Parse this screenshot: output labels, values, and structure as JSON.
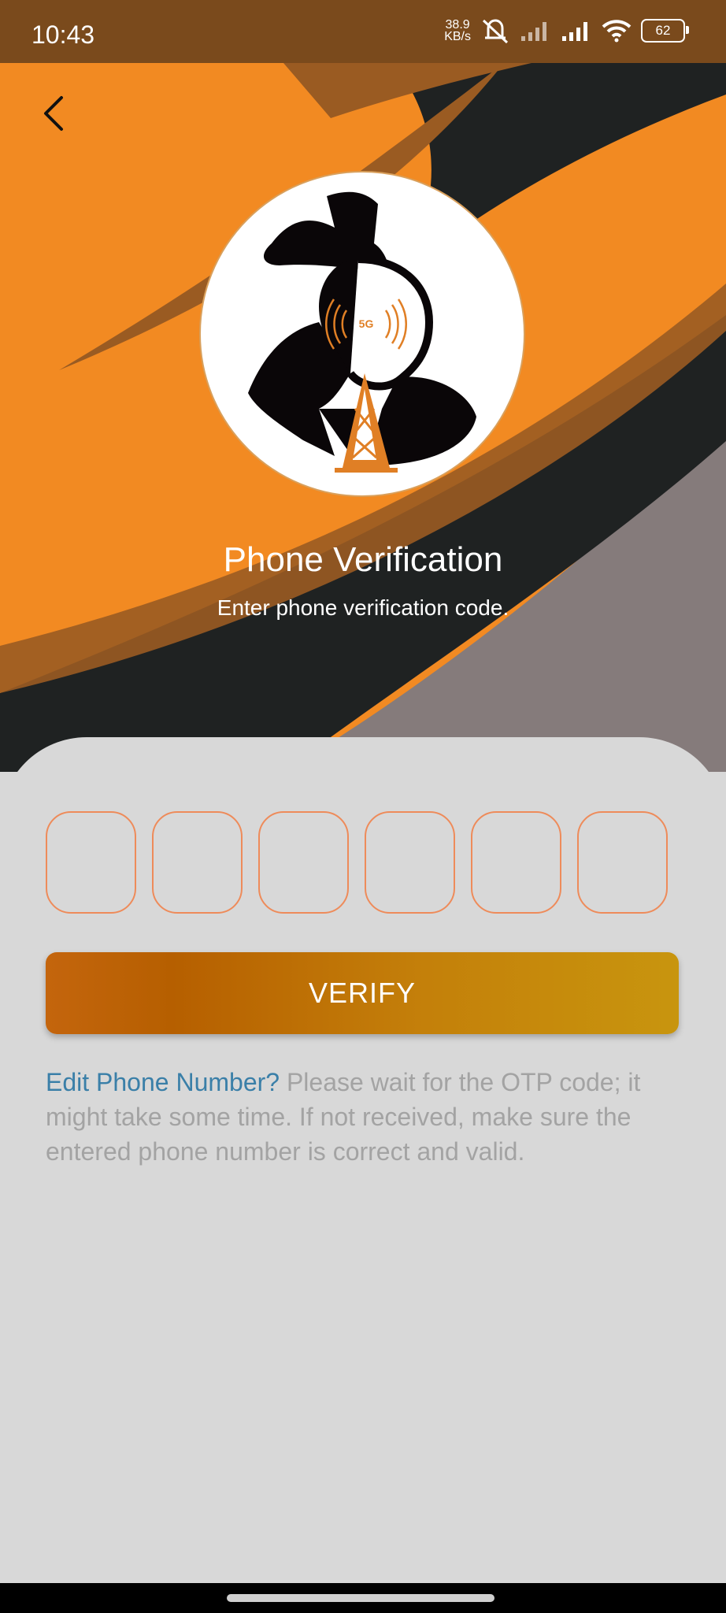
{
  "status_bar": {
    "time": "10:43",
    "net_speed_value": "38.9",
    "net_speed_unit": "KB/s",
    "battery": "62",
    "icons": [
      "mute-icon",
      "signal-icon",
      "signal-icon",
      "wifi-icon",
      "battery-icon"
    ]
  },
  "header": {
    "back_icon": "chevron-left-icon",
    "logo_label": "5G",
    "title": "Phone Verification",
    "subtitle": "Enter phone verification code."
  },
  "otp": {
    "digits": [
      "",
      "",
      "",
      "",
      "",
      ""
    ]
  },
  "verify_button": {
    "label": "VERIFY"
  },
  "note": {
    "link": "Edit Phone Number?",
    "text": " Please wait for the OTP code; it might take some time. If not received, make sure the entered phone number is correct and valid."
  },
  "colors": {
    "orange": "#f28a22",
    "dark": "#1f2222",
    "gray": "#857b7b",
    "card": "#d8d8d8",
    "otp_border": "#ee8b5a",
    "link": "#3a7fa8",
    "note": "#a3a3a3"
  }
}
